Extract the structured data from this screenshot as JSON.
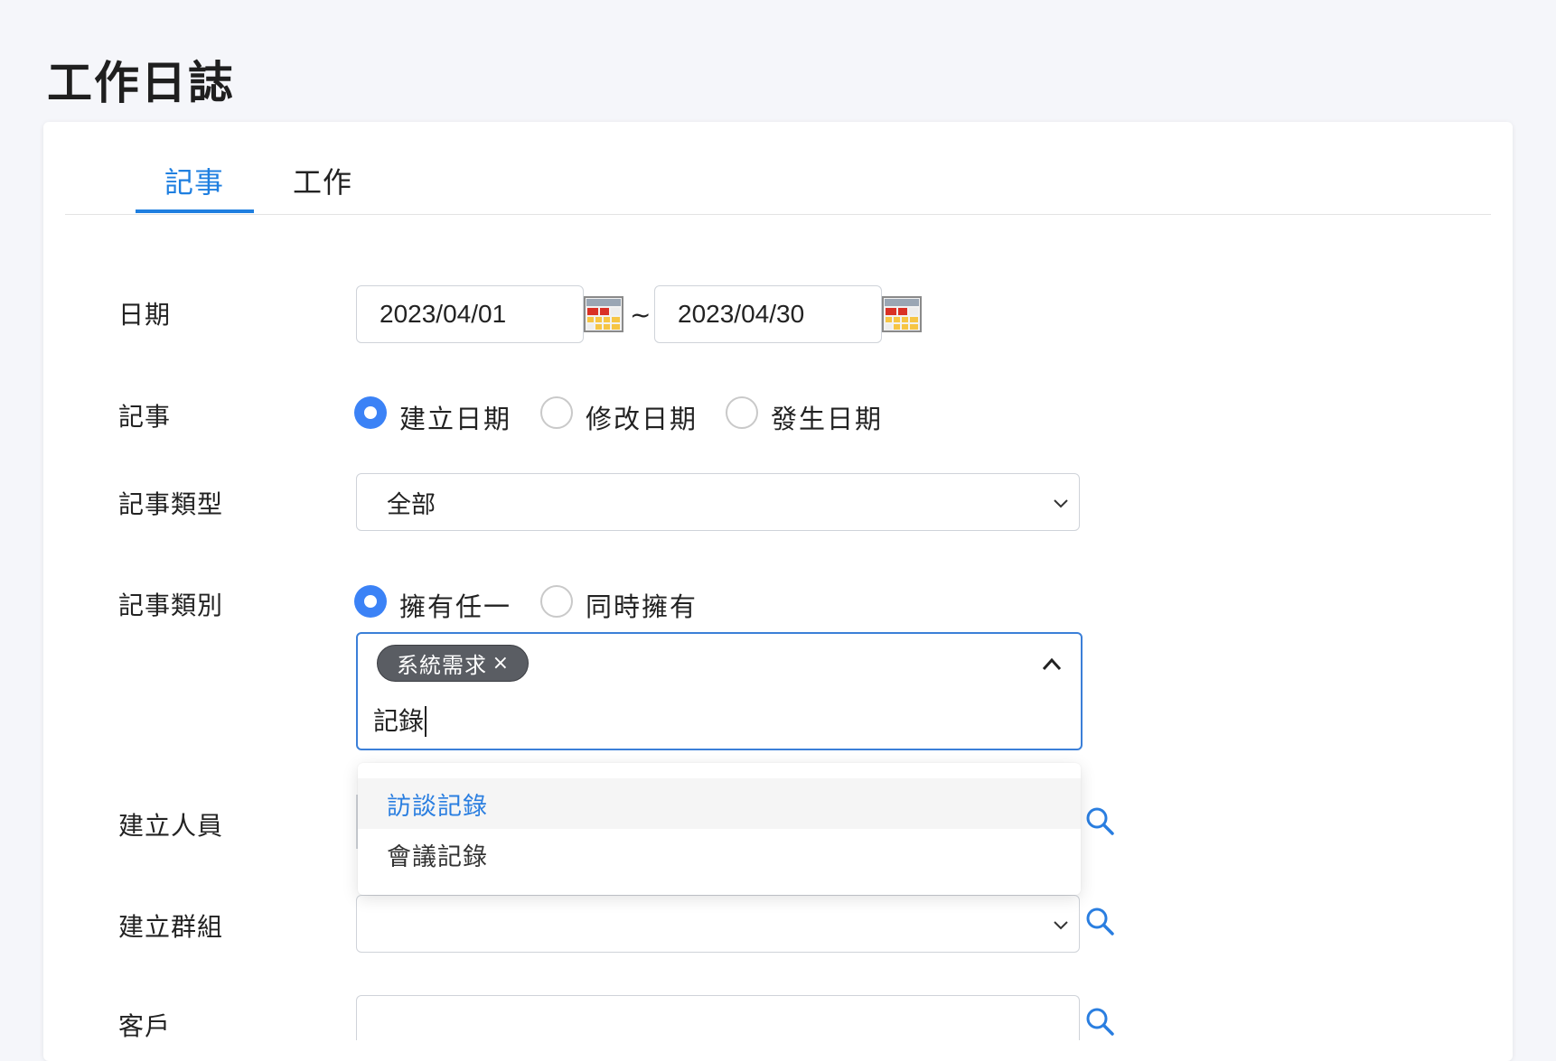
{
  "page": {
    "title": "工作日誌"
  },
  "tabs": [
    {
      "label": "記事",
      "active": true
    },
    {
      "label": "工作",
      "active": false
    }
  ],
  "form": {
    "date": {
      "label": "日期",
      "start": "2023/04/01",
      "end": "2023/04/30",
      "separator": "~"
    },
    "note_date_type": {
      "label": "記事",
      "options": [
        {
          "label": "建立日期",
          "checked": true
        },
        {
          "label": "修改日期",
          "checked": false
        },
        {
          "label": "發生日期",
          "checked": false
        }
      ]
    },
    "note_type": {
      "label": "記事類型",
      "selected": "全部"
    },
    "note_category": {
      "label": "記事類別",
      "options": [
        {
          "label": "擁有任一",
          "checked": true
        },
        {
          "label": "同時擁有",
          "checked": false
        }
      ],
      "chips": [
        {
          "label": "系統需求",
          "remove": "×"
        }
      ],
      "typed": "記錄",
      "suggestions": [
        {
          "label": "訪談記錄",
          "highlighted": true
        },
        {
          "label": "會議記錄",
          "highlighted": false
        }
      ]
    },
    "creator": {
      "label": "建立人員"
    },
    "creator_group": {
      "label": "建立群組",
      "selected": ""
    },
    "customer": {
      "label": "客戶",
      "value": ""
    }
  },
  "colors": {
    "accent": "#1f7fe0",
    "radio_checked": "#3b82f6",
    "chip_bg": "#5a5d63",
    "background": "#f5f6fa"
  }
}
